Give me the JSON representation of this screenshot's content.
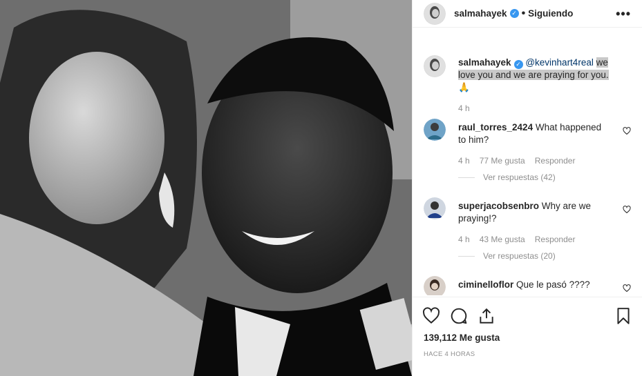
{
  "post": {
    "author": "salmahayek",
    "follow_status": "Siguiendo",
    "dot": "•",
    "more": "•••",
    "photo_alt": "Black and white photo of two people embracing"
  },
  "caption": {
    "author": "salmahayek",
    "mention": "@kevinhart4real",
    "text_highlighted": "we love you and we are praying for you.",
    "emoji": "🙏",
    "time": "4 h"
  },
  "comments": [
    {
      "author": "raul_torres_2424",
      "text": "What happened to him?",
      "time": "4 h",
      "likes": "77 Me gusta",
      "reply": "Responder",
      "view_replies": "Ver respuestas (42)"
    },
    {
      "author": "superjacobsenbro",
      "text": "Why are we praying!?",
      "time": "4 h",
      "likes": "43 Me gusta",
      "reply": "Responder",
      "view_replies": "Ver respuestas (20)"
    },
    {
      "author": "ciminelloflor",
      "text": "Que le pasó ????"
    }
  ],
  "footer": {
    "likes_count": "139,112 Me gusta",
    "posted_ago": "HACE 4 HORAS"
  },
  "icons": {
    "like": "heart-icon",
    "comment": "comment-icon",
    "share": "share-icon",
    "save": "bookmark-icon"
  },
  "colors": {
    "link": "#003569",
    "verified": "#3897f0",
    "muted": "#8e8e8e",
    "highlight": "#c9c9c9"
  }
}
